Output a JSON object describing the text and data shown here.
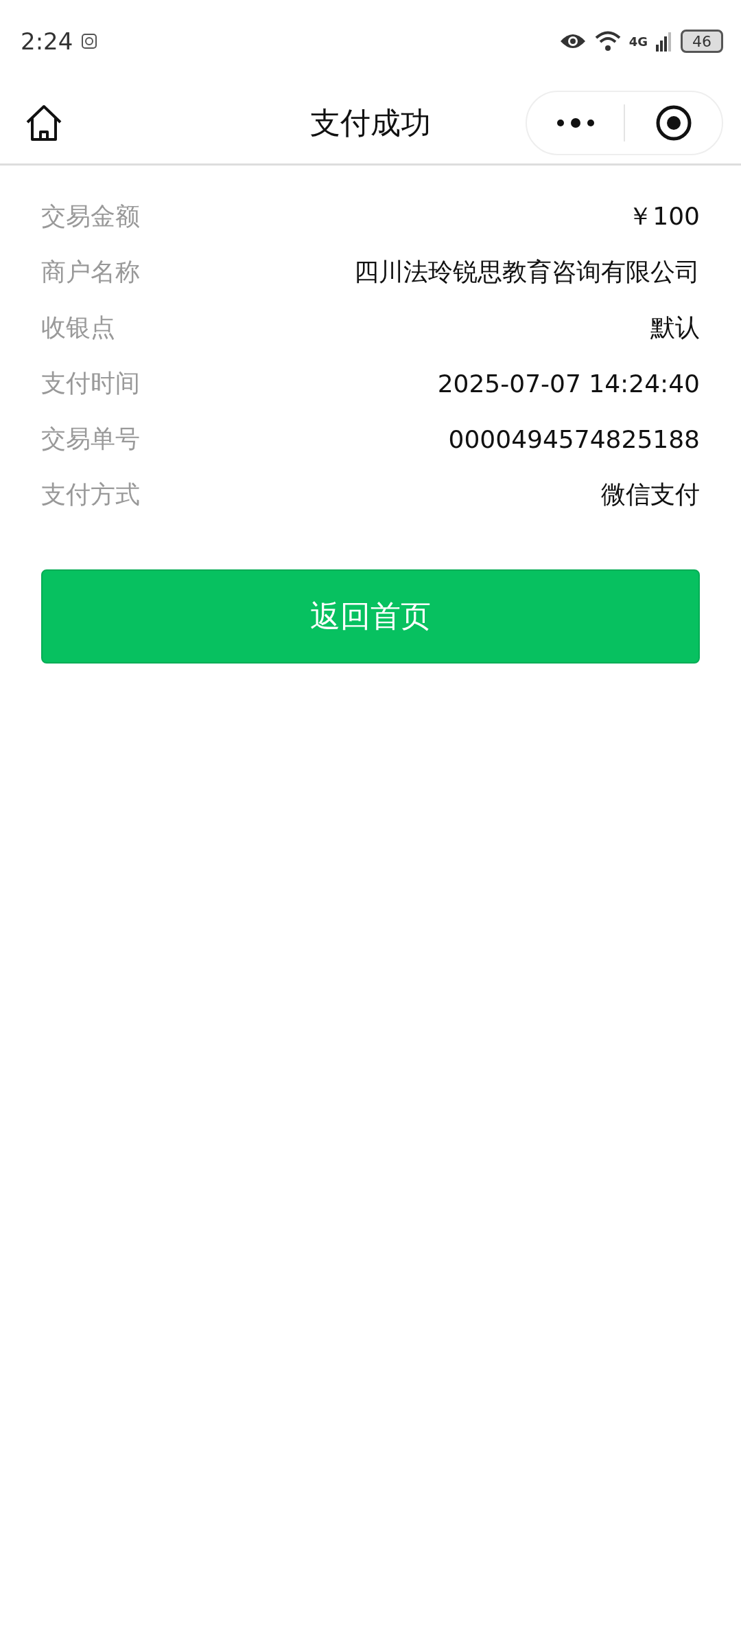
{
  "status_bar": {
    "time": "2:24",
    "network": "4G",
    "battery": "46"
  },
  "nav": {
    "title": "支付成功"
  },
  "details": [
    {
      "label": "交易金额",
      "value": "￥100"
    },
    {
      "label": "商户名称",
      "value": "四川法玲锐思教育咨询有限公司"
    },
    {
      "label": "收银点",
      "value": "默认"
    },
    {
      "label": "支付时间",
      "value": "2025-07-07 14:24:40"
    },
    {
      "label": "交易单号",
      "value": "0000494574825188"
    },
    {
      "label": "支付方式",
      "value": "微信支付"
    }
  ],
  "button": {
    "label": "返回首页"
  }
}
